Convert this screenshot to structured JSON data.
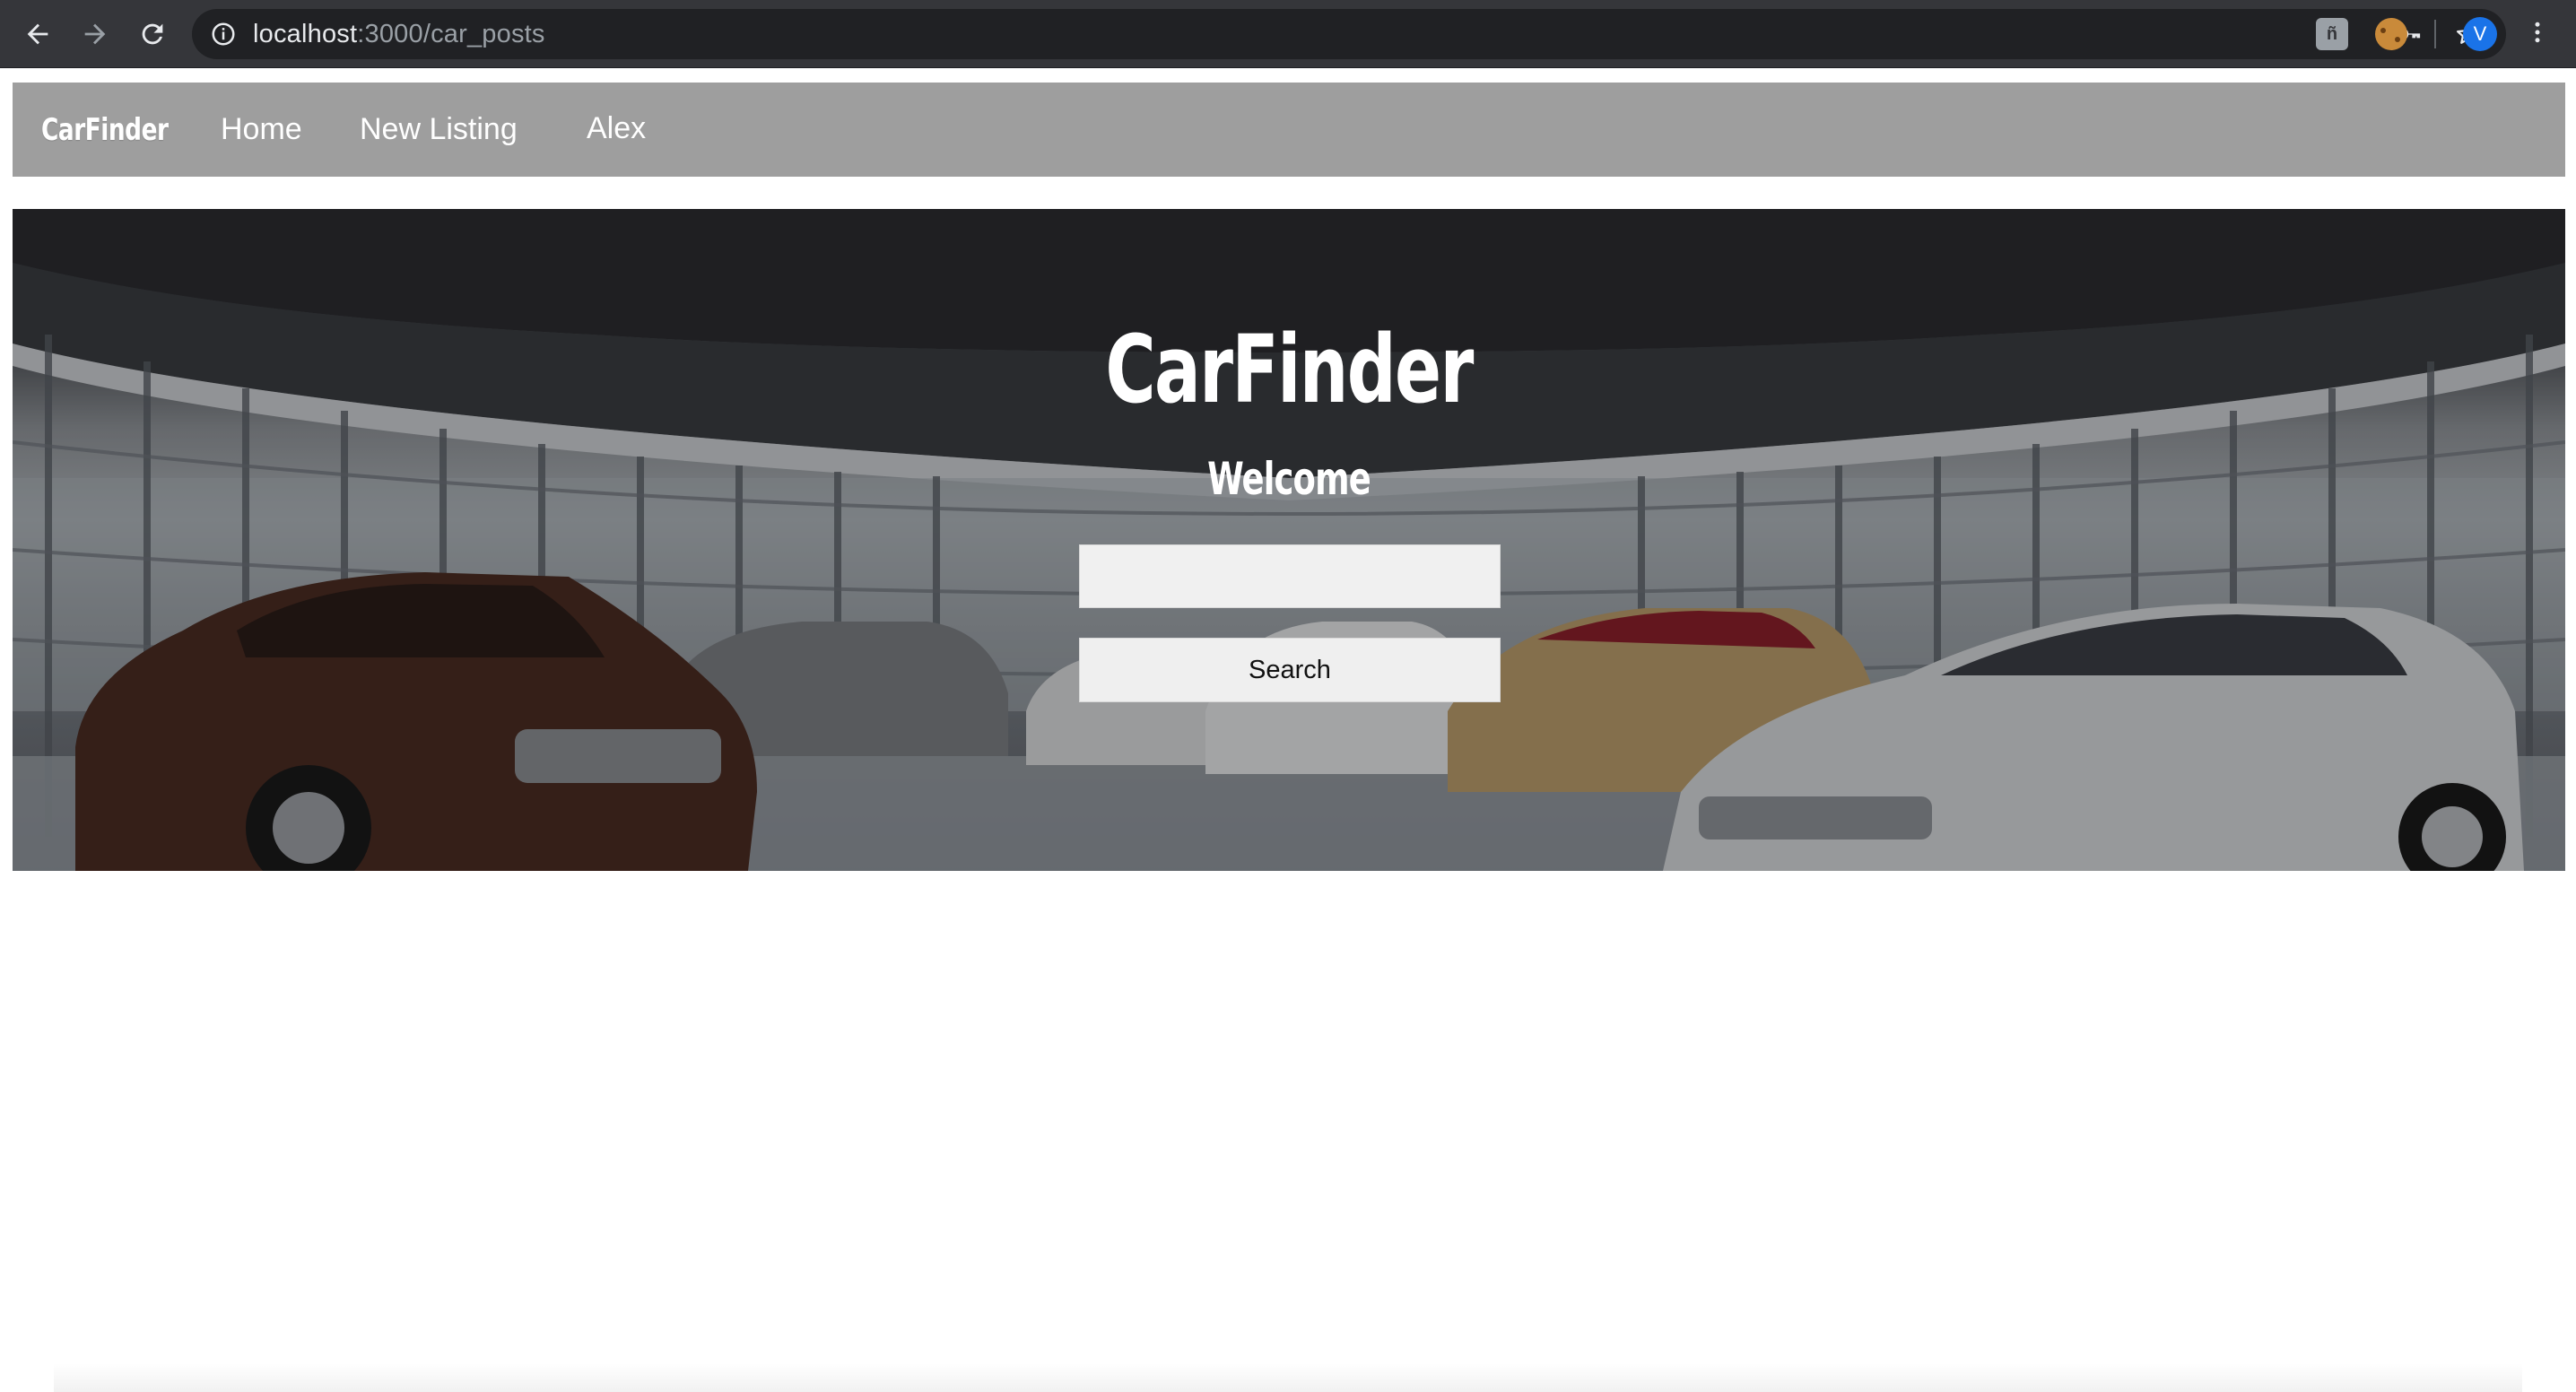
{
  "browser": {
    "url_host": "localhost",
    "url_path": ":3000/car_posts",
    "profile_initial": "V",
    "extension_label": "ñ"
  },
  "site_nav": {
    "brand": "CarFinder",
    "links": [
      "Home",
      "New Listing",
      "Alex"
    ]
  },
  "hero": {
    "title": "CarFinder",
    "subtitle": "Welcome",
    "search_placeholder": "",
    "search_button": "Search"
  },
  "colors": {
    "chrome_bg": "#35363a",
    "omnibox_bg": "#202124",
    "nav_bg": "#9e9e9e",
    "input_bg": "#f0f0f0",
    "avatar_blue": "#1a73e8"
  }
}
